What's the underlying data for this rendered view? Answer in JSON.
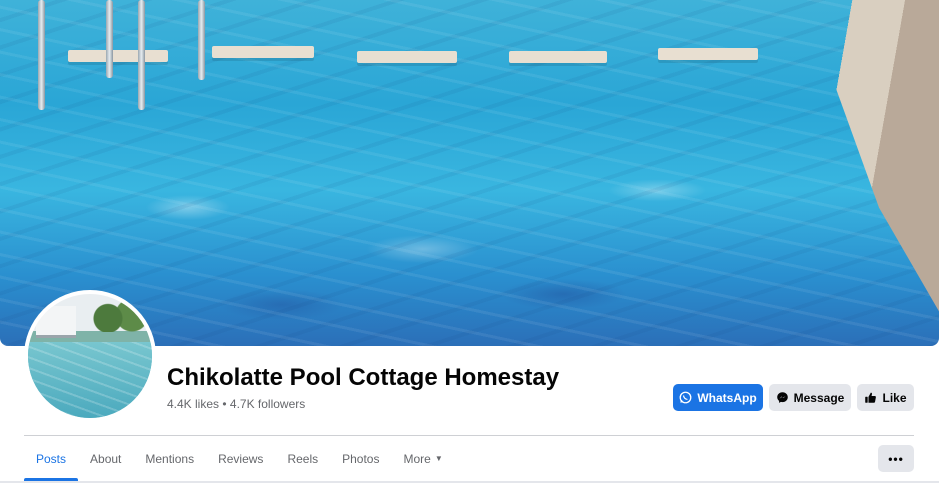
{
  "page": {
    "name": "Chikolatte Pool Cottage Homestay",
    "stats": "4.4K likes • 4.7K followers"
  },
  "actions": {
    "whatsapp_label": "WhatsApp",
    "message_label": "Message",
    "like_label": "Like",
    "more_options_label": "•••"
  },
  "tabs": [
    {
      "label": "Posts",
      "active": true
    },
    {
      "label": "About",
      "active": false
    },
    {
      "label": "Mentions",
      "active": false
    },
    {
      "label": "Reviews",
      "active": false
    },
    {
      "label": "Reels",
      "active": false
    },
    {
      "label": "Photos",
      "active": false
    },
    {
      "label": "More",
      "active": false
    }
  ],
  "icons": {
    "whatsapp": "whatsapp-icon",
    "messenger": "messenger-icon",
    "like": "thumbs-up-icon",
    "more_caret": "caret-down-icon"
  },
  "colors": {
    "accent": "#1b74e4",
    "secondary_button": "#e4e6eb",
    "text_primary": "#050505",
    "text_secondary": "#65676b"
  }
}
